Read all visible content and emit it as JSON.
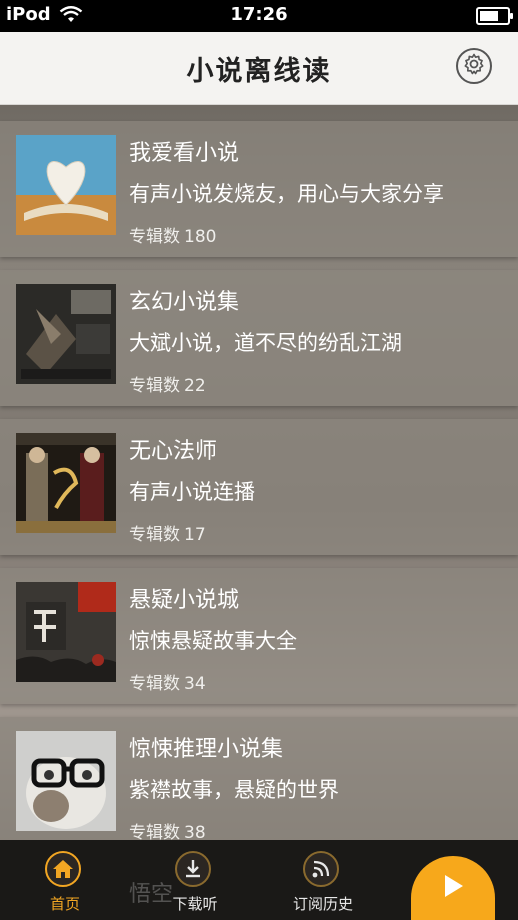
{
  "status_bar": {
    "device": "iPod",
    "time": "17:26"
  },
  "nav": {
    "title": "小说离线读",
    "settings_icon": "gear-icon"
  },
  "count_label": "专辑数",
  "cards": [
    {
      "title": "我爱看小说",
      "desc": "有声小说发烧友，用心与大家分享",
      "count": "180"
    },
    {
      "title": "玄幻小说集",
      "desc": "大斌小说，道不尽的纷乱江湖",
      "count": "22"
    },
    {
      "title": "无心法师",
      "desc": "有声小说连播",
      "count": "17"
    },
    {
      "title": "悬疑小说城",
      "desc": "惊悚悬疑故事大全",
      "count": "34"
    },
    {
      "title": "惊悚推理小说集",
      "desc": "紫襟故事，悬疑的世界",
      "count": "38"
    }
  ],
  "peek_title": "悟空",
  "tabs": [
    {
      "label": "首页",
      "icon": "home-icon",
      "active": true
    },
    {
      "label": "下载听",
      "icon": "download-icon",
      "active": false
    },
    {
      "label": "订阅历史",
      "icon": "rss-icon",
      "active": false
    }
  ],
  "play_icon": "play-icon",
  "colors": {
    "accent": "#f2a623",
    "tab_bar": "#1a1917"
  }
}
